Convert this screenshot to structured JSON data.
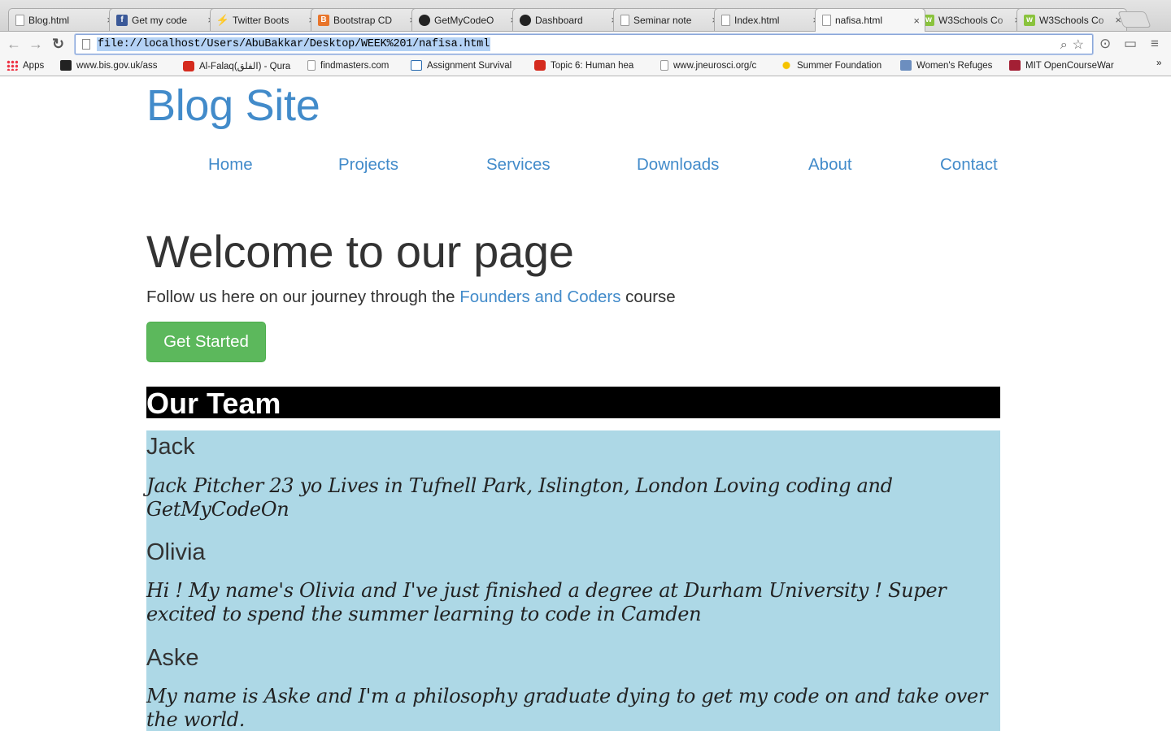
{
  "browser": {
    "tabs": [
      {
        "title": "Blog.html",
        "icon": "doc"
      },
      {
        "title": "Get my code",
        "icon": "fb"
      },
      {
        "title": "Twitter Boots",
        "icon": "tw"
      },
      {
        "title": "Bootstrap CD",
        "icon": "bs"
      },
      {
        "title": "GetMyCodeO",
        "icon": "gh"
      },
      {
        "title": "Dashboard",
        "icon": "gh"
      },
      {
        "title": "Seminar note",
        "icon": "doc"
      },
      {
        "title": "Index.html",
        "icon": "doc"
      },
      {
        "title": "nafisa.html",
        "icon": "doc",
        "active": true
      },
      {
        "title": "W3Schools Co",
        "icon": "w3"
      },
      {
        "title": "W3Schools Co",
        "icon": "w3"
      }
    ],
    "url": "file://localhost/Users/AbuBakkar/Desktop/WEEK%201/nafisa.html",
    "bookmarks": [
      {
        "label": "Apps",
        "icon": "apps"
      },
      {
        "label": "www.bis.gov.uk/ass",
        "icon": "bis"
      },
      {
        "label": "Al-Falaq(الفلق) - Qura",
        "icon": "yt"
      },
      {
        "label": "findmasters.com",
        "icon": "doc"
      },
      {
        "label": "Assignment Survival",
        "icon": "ke"
      },
      {
        "label": "Topic 6: Human hea",
        "icon": "yt"
      },
      {
        "label": "www.jneurosci.org/c",
        "icon": "doc"
      },
      {
        "label": "Summer Foundation",
        "icon": "sun"
      },
      {
        "label": "Women's Refuges",
        "icon": "wr"
      },
      {
        "label": "MIT OpenCourseWar",
        "icon": "mit"
      }
    ],
    "more_bookmarks": "»"
  },
  "site": {
    "title": "Blog Site",
    "nav": [
      "Home",
      "Projects",
      "Services",
      "Downloads",
      "About",
      "Contact"
    ],
    "hero": {
      "heading": "Welcome to our page",
      "lead_before": "Follow us here on our journey through the ",
      "lead_link": "Founders and Coders",
      "lead_after": " course",
      "button": "Get Started"
    },
    "team": {
      "heading": "Our Team",
      "members": [
        {
          "name": "Jack",
          "bio": "Jack Pitcher 23 yo Lives in Tufnell Park, Islington, London Loving coding and GetMyCodeOn"
        },
        {
          "name": "Olivia",
          "bio": "Hi ! My name's Olivia and I've just finished a degree at Durham University ! Super excited to spend the summer learning to code in Camden"
        },
        {
          "name": "Aske",
          "bio": "My name is Aske and I'm a philosophy graduate dying to get my code on and take over the world."
        }
      ]
    }
  },
  "colors": {
    "link": "#428bca",
    "button": "#5cb85c",
    "team_panel": "#add8e6",
    "team_header": "#000000"
  }
}
